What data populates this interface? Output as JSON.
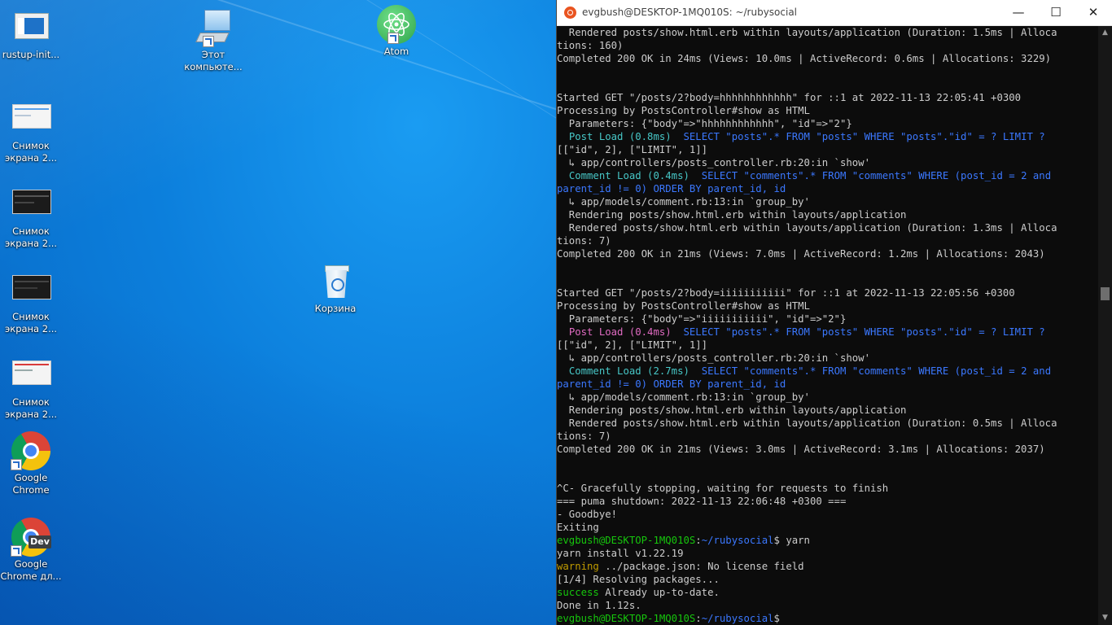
{
  "desktop": {
    "icons": [
      {
        "label": "rustup-init...",
        "kind": "installer-icon"
      },
      {
        "label": "Этот компьюте...",
        "kind": "this-pc-icon"
      },
      {
        "label": "Atom",
        "kind": "atom-icon"
      },
      {
        "label": "Снимок экрана 2...",
        "kind": "screenshot-thumbnail-icon"
      },
      {
        "label": "Снимок экрана 2...",
        "kind": "screenshot-thumbnail-icon"
      },
      {
        "label": "Снимок экрана 2...",
        "kind": "screenshot-thumbnail-icon"
      },
      {
        "label": "Корзина",
        "kind": "recycle-bin-icon"
      },
      {
        "label": "Снимок экрана 2...",
        "kind": "screenshot-thumbnail-icon"
      },
      {
        "label": "Google Chrome",
        "kind": "chrome-icon"
      },
      {
        "label": "Google Chrome дл...",
        "kind": "chrome-dev-icon"
      }
    ]
  },
  "terminal": {
    "title": "evgbush@DESKTOP-1MQ010S: ~/rubysocial",
    "window_buttons": {
      "minimize": "—",
      "maximize": "☐",
      "close": "✕"
    },
    "lines": [
      [
        [
          "w",
          "  Rendered posts/show.html.erb within layouts/application (Duration: 1.5ms | Alloca"
        ]
      ],
      [
        [
          "w",
          "tions: 160)"
        ]
      ],
      [
        [
          "w",
          "Completed 200 OK in 24ms (Views: 10.0ms | ActiveRecord: 0.6ms | Allocations: 3229)"
        ]
      ],
      [
        [
          "w",
          ""
        ]
      ],
      [
        [
          "w",
          ""
        ]
      ],
      [
        [
          "w",
          "Started GET \"/posts/2?body=hhhhhhhhhhhh\" for ::1 at 2022-11-13 22:05:41 +0300"
        ]
      ],
      [
        [
          "w",
          "Processing by PostsController#show as HTML"
        ]
      ],
      [
        [
          "w",
          "  Parameters: {\"body\"=>\"hhhhhhhhhhhh\", \"id\"=>\"2\"}"
        ]
      ],
      [
        [
          "w",
          "  "
        ],
        [
          "cy",
          "Post Load (0.8ms)"
        ],
        [
          "w",
          "  "
        ],
        [
          "bl",
          "SELECT \"posts\".* FROM \"posts\" WHERE \"posts\".\"id\" = ? LIMIT ?"
        ]
      ],
      [
        [
          "w",
          "[[\"id\", 2], [\"LIMIT\", 1]]"
        ]
      ],
      [
        [
          "w",
          "  ↳ app/controllers/posts_controller.rb:20:in `show'"
        ]
      ],
      [
        [
          "w",
          "  "
        ],
        [
          "cy",
          "Comment Load (0.4ms)"
        ],
        [
          "w",
          "  "
        ],
        [
          "bl",
          "SELECT \"comments\".* FROM \"comments\" WHERE (post_id = 2 and"
        ]
      ],
      [
        [
          "bl",
          "parent_id != 0) ORDER BY parent_id, id"
        ]
      ],
      [
        [
          "w",
          "  ↳ app/models/comment.rb:13:in `group_by'"
        ]
      ],
      [
        [
          "w",
          "  Rendering posts/show.html.erb within layouts/application"
        ]
      ],
      [
        [
          "w",
          "  Rendered posts/show.html.erb within layouts/application (Duration: 1.3ms | Alloca"
        ]
      ],
      [
        [
          "w",
          "tions: 7)"
        ]
      ],
      [
        [
          "w",
          "Completed 200 OK in 21ms (Views: 7.0ms | ActiveRecord: 1.2ms | Allocations: 2043)"
        ]
      ],
      [
        [
          "w",
          ""
        ]
      ],
      [
        [
          "w",
          ""
        ]
      ],
      [
        [
          "w",
          "Started GET \"/posts/2?body=iiiiiiiiiii\" for ::1 at 2022-11-13 22:05:56 +0300"
        ]
      ],
      [
        [
          "w",
          "Processing by PostsController#show as HTML"
        ]
      ],
      [
        [
          "w",
          "  Parameters: {\"body\"=>\"iiiiiiiiiii\", \"id\"=>\"2\"}"
        ]
      ],
      [
        [
          "w",
          "  "
        ],
        [
          "m",
          "Post Load (0.4ms)"
        ],
        [
          "w",
          "  "
        ],
        [
          "bl",
          "SELECT \"posts\".* FROM \"posts\" WHERE \"posts\".\"id\" = ? LIMIT ?"
        ]
      ],
      [
        [
          "w",
          "[[\"id\", 2], [\"LIMIT\", 1]]"
        ]
      ],
      [
        [
          "w",
          "  ↳ app/controllers/posts_controller.rb:20:in `show'"
        ]
      ],
      [
        [
          "w",
          "  "
        ],
        [
          "cy",
          "Comment Load (2.7ms)"
        ],
        [
          "w",
          "  "
        ],
        [
          "bl",
          "SELECT \"comments\".* FROM \"comments\" WHERE (post_id = 2 and"
        ]
      ],
      [
        [
          "bl",
          "parent_id != 0) ORDER BY parent_id, id"
        ]
      ],
      [
        [
          "w",
          "  ↳ app/models/comment.rb:13:in `group_by'"
        ]
      ],
      [
        [
          "w",
          "  Rendering posts/show.html.erb within layouts/application"
        ]
      ],
      [
        [
          "w",
          "  Rendered posts/show.html.erb within layouts/application (Duration: 0.5ms | Alloca"
        ]
      ],
      [
        [
          "w",
          "tions: 7)"
        ]
      ],
      [
        [
          "w",
          "Completed 200 OK in 21ms (Views: 3.0ms | ActiveRecord: 3.1ms | Allocations: 2037)"
        ]
      ],
      [
        [
          "w",
          ""
        ]
      ],
      [
        [
          "w",
          ""
        ]
      ],
      [
        [
          "w",
          "^C- Gracefully stopping, waiting for requests to finish"
        ]
      ],
      [
        [
          "w",
          "=== puma shutdown: 2022-11-13 22:06:48 +0300 ==="
        ]
      ],
      [
        [
          "w",
          "- Goodbye!"
        ]
      ],
      [
        [
          "w",
          "Exiting"
        ]
      ],
      [
        [
          "gr",
          "evgbush@DESKTOP-1MQ010S"
        ],
        [
          "w",
          ":"
        ],
        [
          "bl",
          "~/rubysocial"
        ],
        [
          "w",
          "$ yarn"
        ]
      ],
      [
        [
          "w",
          "yarn install v1.22.19"
        ]
      ],
      [
        [
          "ye",
          "warning"
        ],
        [
          "w",
          " ../package.json: No license field"
        ]
      ],
      [
        [
          "w",
          "[1/4] Resolving packages..."
        ]
      ],
      [
        [
          "gr",
          "success"
        ],
        [
          "w",
          " Already up-to-date."
        ]
      ],
      [
        [
          "w",
          "Done in 1.12s."
        ]
      ],
      [
        [
          "gr",
          "evgbush@DESKTOP-1MQ010S"
        ],
        [
          "w",
          ":"
        ],
        [
          "bl",
          "~/rubysocial"
        ],
        [
          "w",
          "$ "
        ]
      ]
    ]
  },
  "colors": {
    "desktop_bg": "#0c7fdc",
    "terminal_bg": "#0c0c0c",
    "prompt_user": "#16c60c",
    "prompt_path": "#3b78ff",
    "sql": "#3b78ff",
    "load_label": "#47c7c7",
    "warning": "#c19c00"
  }
}
